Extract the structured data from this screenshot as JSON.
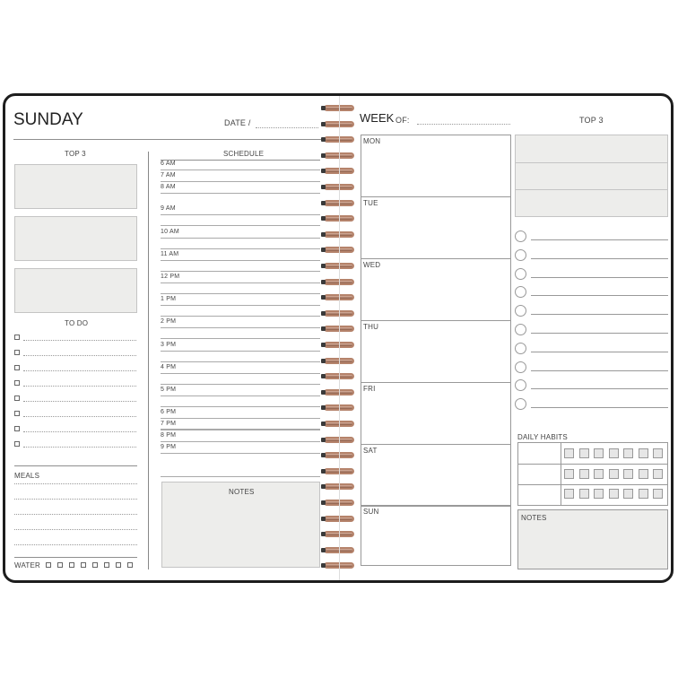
{
  "left_page": {
    "title": "SUNDAY",
    "date_label": "DATE /",
    "top3_label": "TOP 3",
    "todo_label": "TO DO",
    "meals_label": "MEALS",
    "water_label": "WATER",
    "schedule_label": "SCHEDULE",
    "notes_label": "NOTES",
    "schedule_times": [
      "6 AM",
      "7 AM",
      "8 AM",
      "9 AM",
      "10 AM",
      "11 AM",
      "12 PM",
      "1 PM",
      "2 PM",
      "3 PM",
      "4 PM",
      "5 PM",
      "6 PM",
      "7 PM",
      "8 PM",
      "9 PM"
    ]
  },
  "right_page": {
    "week_label": "WEEK",
    "week_of": "OF:",
    "top3_label": "TOP 3",
    "days": [
      "MON",
      "TUE",
      "WED",
      "THU",
      "FRI",
      "SAT",
      "SUN"
    ],
    "daily_habits_label": "DAILY HABITS",
    "notes_label": "NOTES"
  },
  "colors": {
    "border": "#1d1d1d",
    "box_fill": "#ededeb",
    "spiral": "#b5836b"
  }
}
